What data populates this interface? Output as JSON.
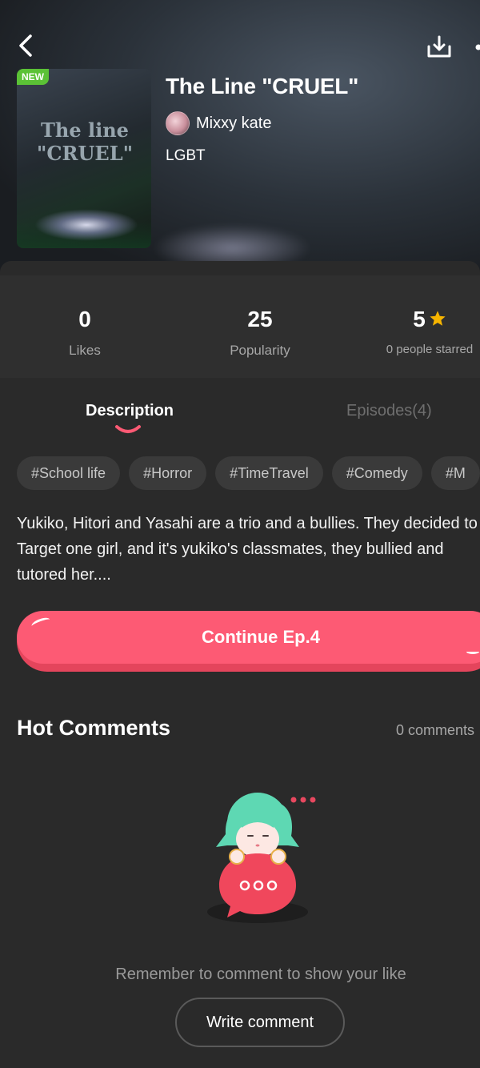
{
  "header": {
    "badge": "NEW",
    "title": "The Line \"CRUEL\"",
    "author": "Mixxy kate",
    "genre": "LGBT",
    "cover_text": "The line \"CRUEL\""
  },
  "stats": {
    "likes_value": "0",
    "likes_label": "Likes",
    "popularity_value": "25",
    "popularity_label": "Popularity",
    "rating_value": "5",
    "rating_label": "0 people starred"
  },
  "tabs": {
    "description": "Description",
    "episodes": "Episodes(4)"
  },
  "tags": [
    "#School life",
    "#Horror",
    "#TimeTravel",
    "#Comedy",
    "#M"
  ],
  "description": "Yukiko, Hitori and Yasahi are a trio and a bullies. They decided to Target one girl, and it's yukiko's classmates, they bullied and tutored her....",
  "continue_label": "Continue Ep.4",
  "comments": {
    "title": "Hot Comments",
    "count": "0 comments",
    "empty_text": "Remember to comment to show your like",
    "write_label": "Write comment"
  },
  "colors": {
    "accent": "#fd5a74",
    "new_badge": "#5bc236",
    "star": "#f7b500",
    "background": "#2a2a2a"
  },
  "icons": {
    "back": "chevron-left-icon",
    "download": "download-icon",
    "more": "more-icon",
    "star": "star-icon"
  }
}
